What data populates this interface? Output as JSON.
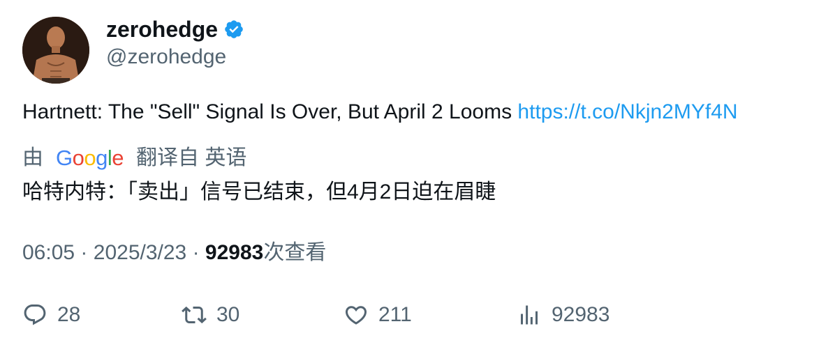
{
  "author": {
    "display_name": "zerohedge",
    "handle": "@zerohedge",
    "verified_color": "#1d9bf0",
    "avatar_icon": "user-avatar"
  },
  "tweet": {
    "text": "Hartnett: The \"Sell\" Signal Is Over, But April 2 Looms ",
    "link": "https://t.co/Nkjn2MYf4N"
  },
  "translation": {
    "by_label": "由",
    "provider_letters": [
      "G",
      "o",
      "o",
      "g",
      "l",
      "e"
    ],
    "from_label": "翻译自 英语",
    "text": "哈特内特：「卖出」信号已结束，但4月2日迫在眉睫"
  },
  "meta": {
    "time": "06:05",
    "separator": "·",
    "date": "2025/3/23",
    "views_count": "92983",
    "views_label": "次查看"
  },
  "actions": {
    "reply_count": "28",
    "retweet_count": "30",
    "like_count": "211",
    "views_count": "92983"
  },
  "colors": {
    "link": "#1d9bf0",
    "muted": "#536471",
    "text": "#0f1419"
  }
}
